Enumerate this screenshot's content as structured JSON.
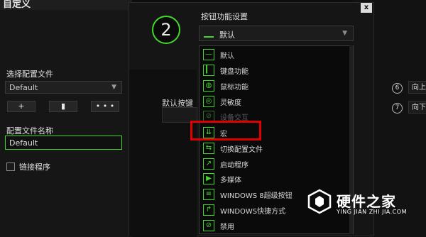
{
  "left_panel": {
    "title": "自定义",
    "profile_label": "选择配置文件",
    "profile_value": "Default",
    "add_label": "+",
    "delete_label": "▮",
    "more_label": "• • •",
    "name_label": "配置文件名称",
    "name_value": "Default",
    "link_label": "链接程序"
  },
  "dialog": {
    "title": "按钮功能设置",
    "close_label": "x",
    "button_number": "2",
    "selected_value": "默认",
    "default_key_label": "默认按键"
  },
  "menu_items": [
    {
      "label": "默认",
      "icon": "default-line-icon",
      "glyph": "—"
    },
    {
      "label": "键盘功能",
      "icon": "keyboard-icon",
      "glyph": "▎"
    },
    {
      "label": "鼠标功能",
      "icon": "mouse-icon",
      "glyph": "◍"
    },
    {
      "label": "灵敏度",
      "icon": "sensitivity-icon",
      "glyph": "◎"
    },
    {
      "label": "设备交互",
      "icon": "device-interaction-icon",
      "glyph": "⊘"
    },
    {
      "label": "宏",
      "icon": "macro-icon",
      "glyph": "⇊"
    },
    {
      "label": "切换配置文件",
      "icon": "switch-profile-icon",
      "glyph": "⇆"
    },
    {
      "label": "启动程序",
      "icon": "launch-program-icon",
      "glyph": "↗"
    },
    {
      "label": "多媒体",
      "icon": "multimedia-icon",
      "glyph": "▶"
    },
    {
      "label": "WINDOWS 8超级按钮",
      "icon": "windows8-charms-icon",
      "glyph": "≡"
    },
    {
      "label": "WINDOWS快捷方式",
      "icon": "windows-shortcut-icon",
      "glyph": "↱"
    },
    {
      "label": "禁用",
      "icon": "disable-icon",
      "glyph": "⊘"
    }
  ],
  "right_side": {
    "num6": "6",
    "num7": "7",
    "up_label": "向上",
    "down_label": "向下"
  },
  "watermark": {
    "title": "硬件之家",
    "subtitle": "YING JIAN ZHI JIA.COM"
  },
  "colors": {
    "accent": "#44d62c",
    "highlight": "#e00000"
  }
}
